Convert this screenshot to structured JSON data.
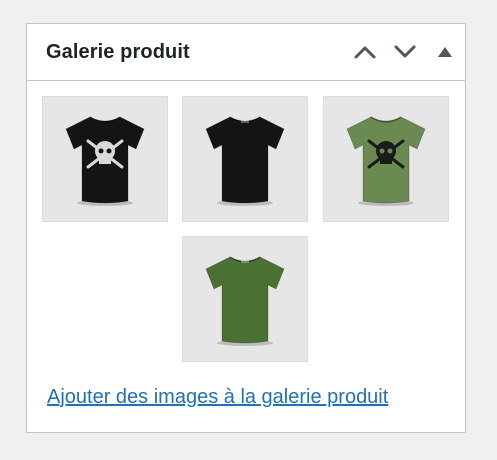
{
  "panel": {
    "title": "Galerie produit",
    "actions": {
      "move_up_icon": "chevron-up-icon",
      "move_down_icon": "chevron-down-icon",
      "toggle_icon": "triangle-up-icon"
    }
  },
  "gallery": {
    "images": [
      {
        "name": "tshirt-black-skull-front",
        "shirt_color": "#141414",
        "print": "skull"
      },
      {
        "name": "tshirt-black-back",
        "shirt_color": "#141414",
        "print": "none"
      },
      {
        "name": "tshirt-green-skull-front",
        "shirt_color": "#6a8a52",
        "print": "skull"
      },
      {
        "name": "tshirt-green-back",
        "shirt_color": "#4a7034",
        "print": "none"
      }
    ]
  },
  "add_images_link": "Ajouter des images à la galerie produit",
  "colors": {
    "link": "#2271b1",
    "title": "#1d2327",
    "border": "#c3c4c7",
    "icon": "#50575e"
  }
}
